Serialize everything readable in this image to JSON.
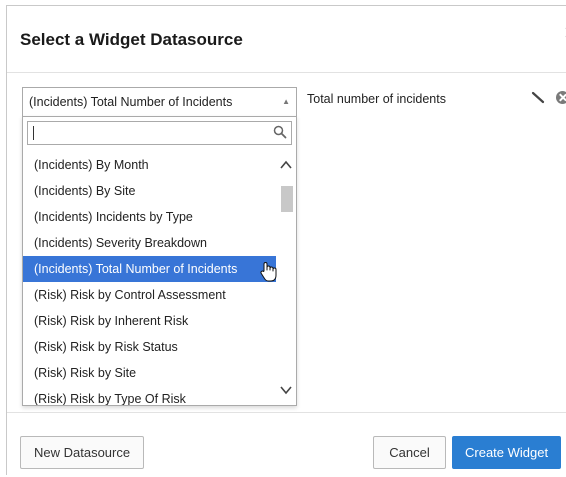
{
  "dialog": {
    "title": "Select a Widget Datasource",
    "close_icon": "close-icon"
  },
  "datasource": {
    "selected_value": "(Incidents) Total Number of Incidents",
    "description": "Total number of incidents",
    "edit_icon": "pencil-icon",
    "delete_icon": "delete-circle-icon"
  },
  "dropdown": {
    "search": {
      "value": "",
      "placeholder": ""
    },
    "options": [
      "(Incidents) By Month",
      "(Incidents) By Site",
      "(Incidents) Incidents by Type",
      "(Incidents) Severity Breakdown",
      "(Incidents) Total Number of Incidents",
      "(Risk) Risk by Control Assessment",
      "(Risk) Risk by Inherent Risk",
      "(Risk) Risk by Risk Status",
      "(Risk) Risk by Site",
      "(Risk) Risk by Type Of Risk"
    ],
    "highlighted_index": 4
  },
  "footer": {
    "new_datasource_label": "New Datasource",
    "cancel_label": "Cancel",
    "create_widget_label": "Create Widget"
  },
  "colors": {
    "accent": "#3875d7",
    "primary_button": "#2a7ed2"
  }
}
